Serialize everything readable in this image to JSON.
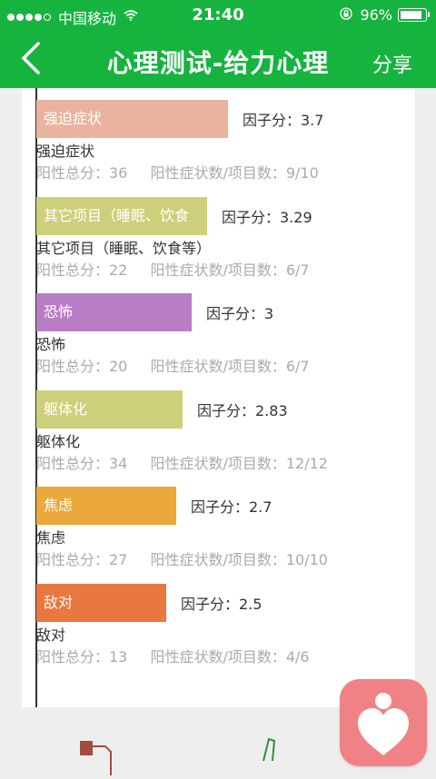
{
  "status_bar": {
    "carrier": "中国移动",
    "time": "21:40",
    "battery": "96%",
    "battery_level": 0.96
  },
  "nav": {
    "title": "心理测试-给力心理",
    "share_label": "分享"
  },
  "factors": [
    {
      "bar_label": "强迫症状",
      "score_text": "因子分：3.7",
      "score": 3.7,
      "color": "#eab39e",
      "name": "强迫症状",
      "total_text": "阳性总分：36",
      "ratio_text": "阳性症状数/项目数：9/10"
    },
    {
      "bar_label": "其它项目（睡眠、饮食",
      "score_text": "因子分：3.29",
      "score": 3.29,
      "color": "#cdd07a",
      "name": "其它项目（睡眠、饮食等）",
      "total_text": "阳性总分：22",
      "ratio_text": "阳性症状数/项目数：6/7"
    },
    {
      "bar_label": "恐怖",
      "score_text": "因子分：3",
      "score": 3,
      "color": "#b97dc5",
      "name": "恐怖",
      "total_text": "阳性总分：20",
      "ratio_text": "阳性症状数/项目数：6/7"
    },
    {
      "bar_label": "躯体化",
      "score_text": "因子分：2.83",
      "score": 2.83,
      "color": "#cdd07a",
      "name": "躯体化",
      "total_text": "阳性总分：34",
      "ratio_text": "阳性症状数/项目数：12/12"
    },
    {
      "bar_label": "焦虑",
      "score_text": "因子分：2.7",
      "score": 2.7,
      "color": "#eaa93a",
      "name": "焦虑",
      "total_text": "阳性总分：27",
      "ratio_text": "阳性症状数/项目数：10/10"
    },
    {
      "bar_label": "敌对",
      "score_text": "因子分：2.5",
      "score": 2.5,
      "color": "#ea7640",
      "name": "敌对",
      "total_text": "阳性总分：13",
      "ratio_text": "阳性症状数/项目数：4/6"
    }
  ],
  "colors": {
    "header_green": "#16b43f",
    "stats_gray": "#aaaaaa",
    "app_icon_pink": "#f08184"
  },
  "icons": {
    "back": "chevron-left-icon",
    "lock": "rotation-lock-icon",
    "wifi": "wifi-icon",
    "app": "heart-person-icon"
  }
}
